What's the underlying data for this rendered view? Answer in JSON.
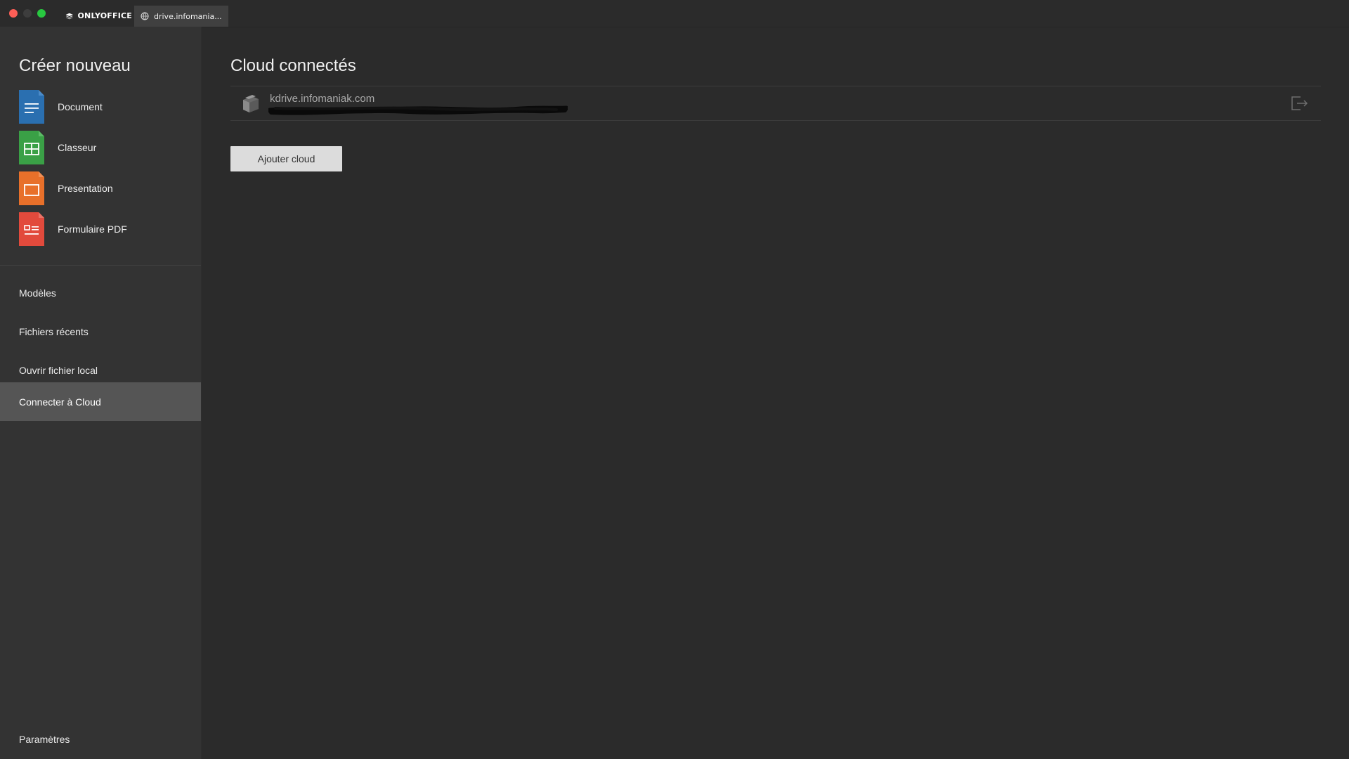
{
  "titlebar": {
    "home_tab_label": "ONLYOFFICE",
    "cloud_tab_label": "drive.infomania..."
  },
  "sidebar": {
    "create_title": "Créer nouveau",
    "create_items": [
      {
        "label": "Document",
        "icon": "document-icon",
        "color": "#2a6fb0"
      },
      {
        "label": "Classeur",
        "icon": "spreadsheet-icon",
        "color": "#3aa046"
      },
      {
        "label": "Presentation",
        "icon": "presentation-icon",
        "color": "#e8702a"
      },
      {
        "label": "Formulaire PDF",
        "icon": "pdf-form-icon",
        "color": "#e24a3c"
      }
    ],
    "nav_items": [
      {
        "label": "Modèles"
      },
      {
        "label": "Fichiers récents"
      },
      {
        "label": "Ouvrir fichier local"
      },
      {
        "label": "Connecter à Cloud"
      }
    ],
    "active_item": "Connecter à Cloud",
    "settings_label": "Paramètres"
  },
  "main": {
    "title": "Cloud connectés",
    "clouds": [
      {
        "name": "kdrive.infomaniak.com",
        "user": "",
        "icon": "cloud-server-icon"
      }
    ],
    "add_button_label": "Ajouter cloud"
  },
  "colors": {
    "background": "#2b2b2b",
    "sidebar": "#333333",
    "active_nav": "#555555",
    "button": "#dcdcdc"
  }
}
